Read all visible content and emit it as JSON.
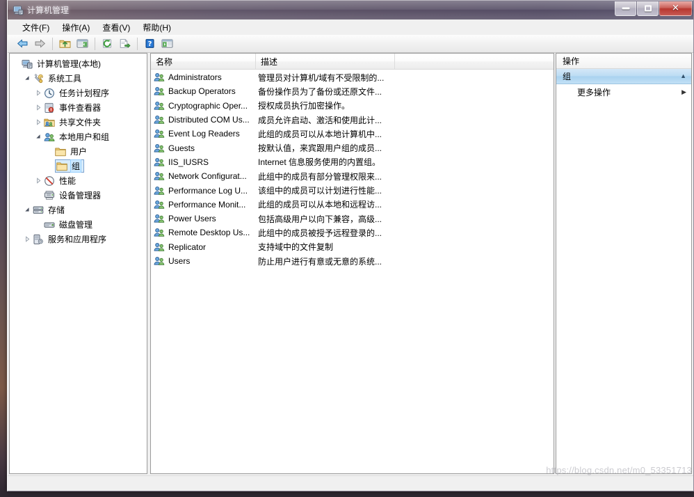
{
  "window": {
    "title": "计算机管理",
    "icon": "computer-management-icon",
    "controls": {
      "minimize": "最小化",
      "maximize": "最大化",
      "close": "关闭"
    }
  },
  "menubar": {
    "items": [
      {
        "label": "文件(F)",
        "name": "menu-file"
      },
      {
        "label": "操作(A)",
        "name": "menu-action"
      },
      {
        "label": "查看(V)",
        "name": "menu-view"
      },
      {
        "label": "帮助(H)",
        "name": "menu-help"
      }
    ]
  },
  "toolbar": {
    "buttons": [
      {
        "icon": "back-arrow-icon",
        "title": "后退"
      },
      {
        "icon": "forward-arrow-icon",
        "title": "前进"
      },
      {
        "icon": "up-folder-icon",
        "title": "上移一级"
      },
      {
        "icon": "show-hide-console-tree-icon",
        "title": "显示/隐藏控制台树"
      },
      {
        "icon": "refresh-icon",
        "title": "刷新"
      },
      {
        "icon": "export-list-icon",
        "title": "导出列表"
      },
      {
        "icon": "help-icon",
        "title": "帮助"
      },
      {
        "icon": "show-action-pane-icon",
        "title": "显示/隐藏操作窗格"
      }
    ]
  },
  "tree": {
    "nodes": [
      {
        "label": "计算机管理(本地)",
        "icon": "computer-icon",
        "depth": 0,
        "twisty": "none",
        "selected": false
      },
      {
        "label": "系统工具",
        "icon": "system-tools-icon",
        "depth": 1,
        "twisty": "expanded",
        "selected": false
      },
      {
        "label": "任务计划程序",
        "icon": "task-scheduler-icon",
        "depth": 2,
        "twisty": "collapsed",
        "selected": false
      },
      {
        "label": "事件查看器",
        "icon": "event-viewer-icon",
        "depth": 2,
        "twisty": "collapsed",
        "selected": false
      },
      {
        "label": "共享文件夹",
        "icon": "shared-folders-icon",
        "depth": 2,
        "twisty": "collapsed",
        "selected": false
      },
      {
        "label": "本地用户和组",
        "icon": "local-users-groups-icon",
        "depth": 2,
        "twisty": "expanded",
        "selected": false
      },
      {
        "label": "用户",
        "icon": "folder-icon",
        "depth": 3,
        "twisty": "none",
        "selected": false
      },
      {
        "label": "组",
        "icon": "folder-icon",
        "depth": 3,
        "twisty": "none",
        "selected": true
      },
      {
        "label": "性能",
        "icon": "performance-icon",
        "depth": 2,
        "twisty": "collapsed",
        "selected": false
      },
      {
        "label": "设备管理器",
        "icon": "device-manager-icon",
        "depth": 2,
        "twisty": "none",
        "selected": false
      },
      {
        "label": "存储",
        "icon": "storage-icon",
        "depth": 1,
        "twisty": "expanded",
        "selected": false
      },
      {
        "label": "磁盘管理",
        "icon": "disk-management-icon",
        "depth": 2,
        "twisty": "none",
        "selected": false
      },
      {
        "label": "服务和应用程序",
        "icon": "services-apps-icon",
        "depth": 1,
        "twisty": "collapsed",
        "selected": false
      }
    ]
  },
  "list": {
    "columns": [
      {
        "label": "名称",
        "name": "column-name"
      },
      {
        "label": "描述",
        "name": "column-description"
      },
      {
        "label": "",
        "name": "column-empty"
      }
    ],
    "rows": [
      {
        "name": "Administrators",
        "description": "管理员对计算机/域有不受限制的..."
      },
      {
        "name": "Backup Operators",
        "description": "备份操作员为了备份或还原文件..."
      },
      {
        "name": "Cryptographic Oper...",
        "description": "授权成员执行加密操作。"
      },
      {
        "name": "Distributed COM Us...",
        "description": "成员允许启动、激活和使用此计..."
      },
      {
        "name": "Event Log Readers",
        "description": "此组的成员可以从本地计算机中..."
      },
      {
        "name": "Guests",
        "description": "按默认值，来宾跟用户组的成员..."
      },
      {
        "name": "IIS_IUSRS",
        "description": "Internet 信息服务使用的内置组。"
      },
      {
        "name": "Network Configurat...",
        "description": "此组中的成员有部分管理权限来..."
      },
      {
        "name": "Performance Log U...",
        "description": "该组中的成员可以计划进行性能..."
      },
      {
        "name": "Performance Monit...",
        "description": "此组的成员可以从本地和远程访..."
      },
      {
        "name": "Power Users",
        "description": "包括高级用户以向下兼容，高级..."
      },
      {
        "name": "Remote Desktop Us...",
        "description": "此组中的成员被授予远程登录的..."
      },
      {
        "name": "Replicator",
        "description": "支持域中的文件复制"
      },
      {
        "name": "Users",
        "description": "防止用户进行有意或无意的系统..."
      }
    ]
  },
  "actions": {
    "title": "操作",
    "group_header": "组",
    "items": [
      {
        "label": "更多操作",
        "name": "action-more-actions"
      }
    ]
  },
  "statusbar": {
    "text": ""
  },
  "watermark": {
    "text": "https://blog.csdn.net/m0_53351713"
  },
  "colors": {
    "accent": "#a9d2ef",
    "selection": "#d8ecfb",
    "selection_border": "#7da2ce",
    "close_button": "#a8231c",
    "title_glass": "#544a60"
  }
}
